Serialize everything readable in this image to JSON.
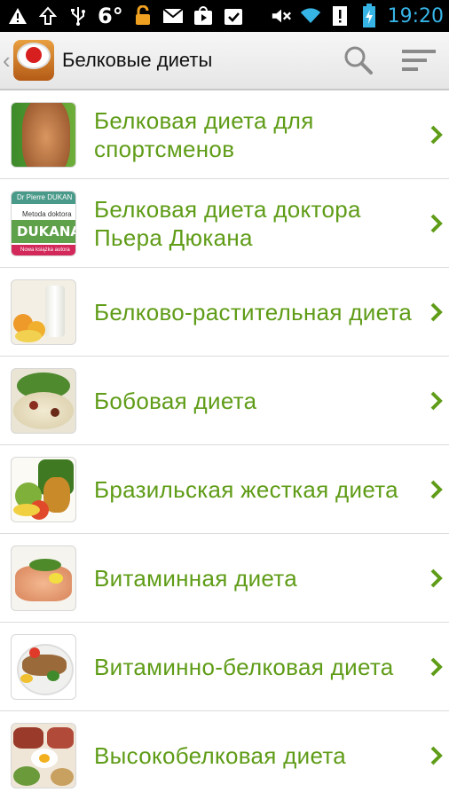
{
  "status_bar": {
    "temperature": "6°",
    "time": "19:20",
    "icons_left": [
      "warning-icon",
      "upload-icon",
      "usb-icon",
      "lock-icon",
      "gmail-icon",
      "play-store-icon",
      "task-icon"
    ],
    "icons_right": [
      "mute-icon",
      "wifi-icon",
      "alert-icon",
      "battery-charging-icon"
    ]
  },
  "action_bar": {
    "title": "Белковые диеты",
    "actions": [
      "search-icon",
      "sort-icon"
    ]
  },
  "list": {
    "accent_color": "#5f9c17",
    "items": [
      {
        "label": "Белковая диета для спортсменов",
        "thumb": "abs"
      },
      {
        "label": "Белковая диета доктора Пьера Дюкана",
        "thumb": "dukan",
        "thumb_text": {
          "author": "Dr Pierre DUKAN",
          "sub": "Metoda doktora",
          "title": "DUKANA",
          "foot": "Nowa książka autora"
        }
      },
      {
        "label": "Белково-растительная диета",
        "thumb": "milk"
      },
      {
        "label": "Бобовая диета",
        "thumb": "beans"
      },
      {
        "label": "Бразильская жесткая диета",
        "thumb": "fruits"
      },
      {
        "label": "Витаминная диета",
        "thumb": "fish"
      },
      {
        "label": "Витаминно-белковая диета",
        "thumb": "grill"
      },
      {
        "label": "Высокобелковая диета",
        "thumb": "meat"
      }
    ]
  }
}
